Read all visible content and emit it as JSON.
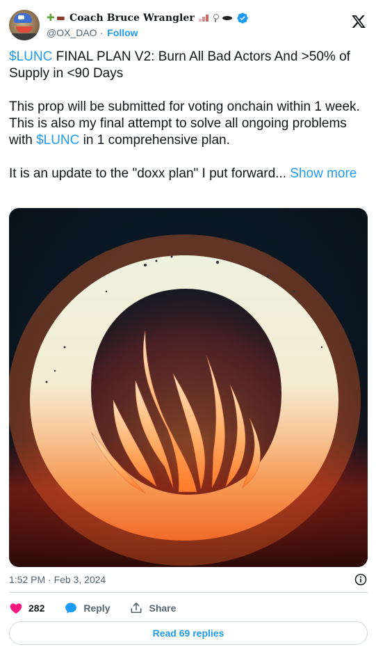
{
  "author": {
    "display_name": "Coach Bruce Wrangler",
    "handle": "@OX_DAO",
    "separator": "·",
    "follow_label": "Follow",
    "verified": true,
    "name_emojis": [
      "puzzle-piece-emoji",
      "ox-emoji"
    ],
    "name_suffix_emojis": [
      "bar-chart-emoji",
      "map-pin-emoji",
      "disc-emoji"
    ]
  },
  "platform_icon": "x-logo",
  "tweet": {
    "paragraphs": [
      {
        "segments": [
          {
            "text": "$LUNC",
            "type": "cashtag"
          },
          {
            "text": " FINAL PLAN V2: Burn All Bad Actors And >50% of Supply in <90 Days",
            "type": "text"
          }
        ]
      },
      {
        "segments": [
          {
            "text": "This prop will be submitted for voting onchain within 1 week. This is also my final attempt to solve all ongoing problems with ",
            "type": "text"
          },
          {
            "text": "$LUNC",
            "type": "cashtag"
          },
          {
            "text": " in 1 comprehensive plan.",
            "type": "text"
          }
        ]
      },
      {
        "segments": [
          {
            "text": "It is an update to the \"doxx plan\" I put forward... ",
            "type": "text"
          },
          {
            "text": "Show more",
            "type": "show_more"
          }
        ]
      }
    ],
    "media": {
      "kind": "image",
      "subject": "glowing-ring-with-flames"
    },
    "timestamp": "1:52 PM · Feb 3, 2024"
  },
  "actions": {
    "like_count": "282",
    "reply_label": "Reply",
    "share_label": "Share"
  },
  "read_replies_label": "Read 69 replies",
  "colors": {
    "accent": "#1d9bf0",
    "like": "#f91880",
    "text": "#0f1419",
    "muted": "#536471",
    "border": "#cfd9de"
  }
}
